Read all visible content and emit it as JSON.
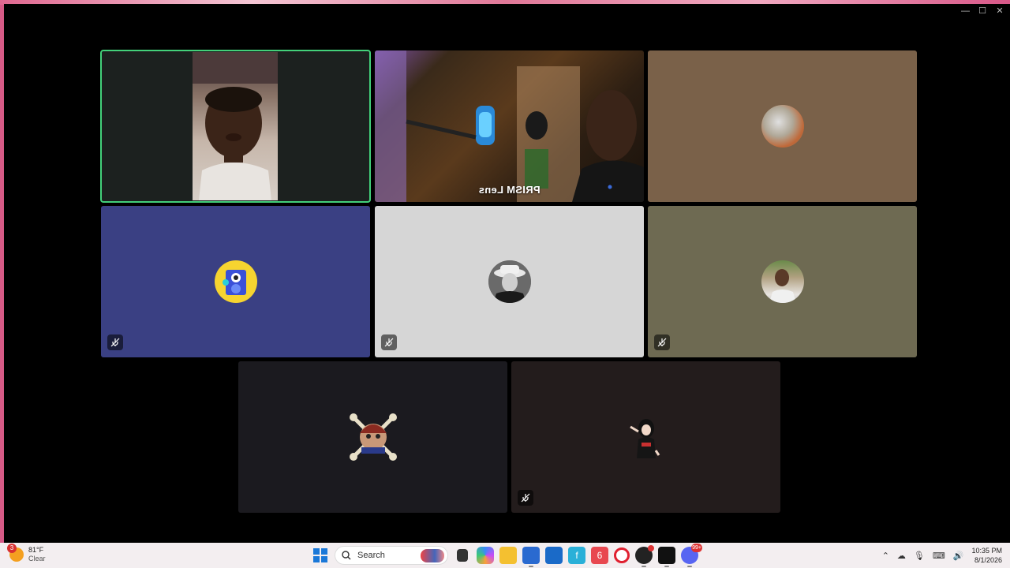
{
  "window": {
    "controls": [
      "—",
      "☐",
      "✕"
    ]
  },
  "tiles": [
    {
      "id": "self-video",
      "type": "video",
      "speaking": true,
      "muted": false,
      "bg": "#1c211f"
    },
    {
      "id": "prism-video",
      "type": "video",
      "speaking": false,
      "muted": false,
      "label": "PRISM Lens",
      "bg": "#3a2a18"
    },
    {
      "id": "participant-3",
      "type": "avatar",
      "muted": false,
      "bg": "#7a6149"
    },
    {
      "id": "participant-4",
      "type": "avatar",
      "muted": true,
      "bg": "#3a4083"
    },
    {
      "id": "participant-5",
      "type": "avatar",
      "muted": true,
      "bg": "#d6d6d6"
    },
    {
      "id": "participant-6",
      "type": "avatar",
      "muted": true,
      "bg": "#6e6a52"
    },
    {
      "id": "participant-7",
      "type": "avatar",
      "muted": false,
      "bg": "#1b1a1f"
    },
    {
      "id": "participant-8",
      "type": "avatar",
      "muted": true,
      "bg": "#231c1c"
    }
  ],
  "taskbar": {
    "weather": {
      "temp": "81°F",
      "condition": "Clear",
      "badge": "3"
    },
    "search_label": "Search",
    "apps": [
      "start",
      "search",
      "task-view",
      "copilot",
      "file-explorer",
      "microsoft-store",
      "outlook",
      "finance",
      "app-6",
      "opera",
      "music",
      "capcut",
      "discord"
    ],
    "discord_badge": "99+",
    "time": "10:35 PM",
    "date": "8/1/2026"
  }
}
